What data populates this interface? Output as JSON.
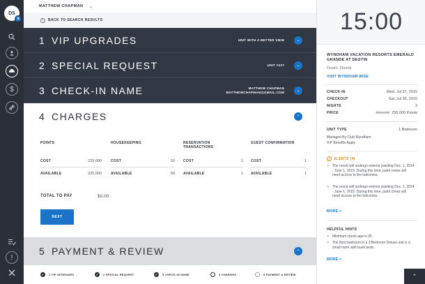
{
  "user": {
    "initials": "DS",
    "badge": "s",
    "name": "MATTHEW CHAPMAN"
  },
  "nav": {
    "back_label": "BACK TO SEARCH RESULTS"
  },
  "rail_icons": [
    "search-icon",
    "user-icon",
    "car-icon",
    "dollar-icon",
    "link-icon",
    "checklist-icon",
    "alert-icon",
    "tools-icon"
  ],
  "steps": [
    {
      "num": "1",
      "title": "VIP UPGRADES",
      "meta": "UNIT WITH A BETTER VIEW"
    },
    {
      "num": "2",
      "title": "SPECIAL REQUEST",
      "meta": "UNIT #237"
    },
    {
      "num": "3",
      "title": "CHECK-IN NAME",
      "meta_line1": "MATTHEW CHAPMAN",
      "meta_line2": "MATTHEWCHAPMAN@GMAIL.COM"
    }
  ],
  "charges": {
    "num": "4",
    "title": "CHARGES",
    "columns": [
      {
        "header": "POINTS",
        "cost_label": "COST",
        "cost": "225,000",
        "avail_label": "AVAILABLE",
        "avail": "225,000"
      },
      {
        "header": "HOUSEKEEPING",
        "cost_label": "COST",
        "cost": "50",
        "avail_label": "AVAILABLE",
        "avail": "50"
      },
      {
        "header": "RESERVATION TRANSACTIONS",
        "cost_label": "COST",
        "cost": "1",
        "avail_label": "AVAILABLE",
        "avail": "1"
      },
      {
        "header": "GUEST CONFIRMATION",
        "cost_label": "COST",
        "cost": "1",
        "avail_label": "AVAILABLE",
        "avail": "1"
      }
    ],
    "total_label": "TOTAL TO PAY",
    "total_value": "$0.00",
    "next_label": "NEXT"
  },
  "step5": {
    "num": "5",
    "title": "PAYMENT & REVIEW"
  },
  "progress": [
    {
      "label": "1 VIP UPGRADES",
      "state": "done"
    },
    {
      "label": "2 SPECIAL REQUEST",
      "state": "done"
    },
    {
      "label": "3 CHECK-IN NAME",
      "state": "done"
    },
    {
      "label": "4 CHARGES",
      "state": "current"
    },
    {
      "label": "5 PAYMENT & REVIEW",
      "state": "todo"
    }
  ],
  "panel": {
    "clock": "15:00",
    "resort_name": "WYNDHAM VACATION RESORTS EMERALD GRANDE AT DESTIN",
    "location": "Destin, Florida",
    "visit_link": "VISIT WYNDHAM WISE",
    "checkin_label": "CHECK-IN",
    "checkin": "Wed. Jul 27, 2015",
    "checkout_label": "CHECKOUT",
    "checkout": "Sat. Jul 30, 2015",
    "nights_label": "NIGHTS",
    "nights": "3",
    "price_label": "PRICE",
    "price_old": "300,000",
    "price_new": "255,000 Points",
    "unit_type_label": "UNIT TYPE",
    "unit_type": "1 Bedroom",
    "managed_by": "Managed By Club Wyndham",
    "vip_benefits": "VIP Benefits Apply",
    "alerts_title": "ALERTS (4)",
    "alerts": [
      "The resort will undergo exterior painting Dec. 1, 2014 - June 1, 2015. During this time, paint crews will need access to the balconies.",
      "The resort will undergo exterior painting Dec. 1, 2014 - June 1, 2015. During this time, paint crews will need access to the balconies."
    ],
    "more_label": "MORE +",
    "hints_title": "HELPFUL HINTS",
    "hints": [
      "Minimum check-age is 25",
      "The third bedroom in a 3 Bedroom Deluxe unit is a small room with bunk beds."
    ],
    "more_label_2": "MORE +"
  },
  "colors": {
    "accent": "#1a73c7",
    "dark": "#323744",
    "alert": "#e58a12"
  }
}
